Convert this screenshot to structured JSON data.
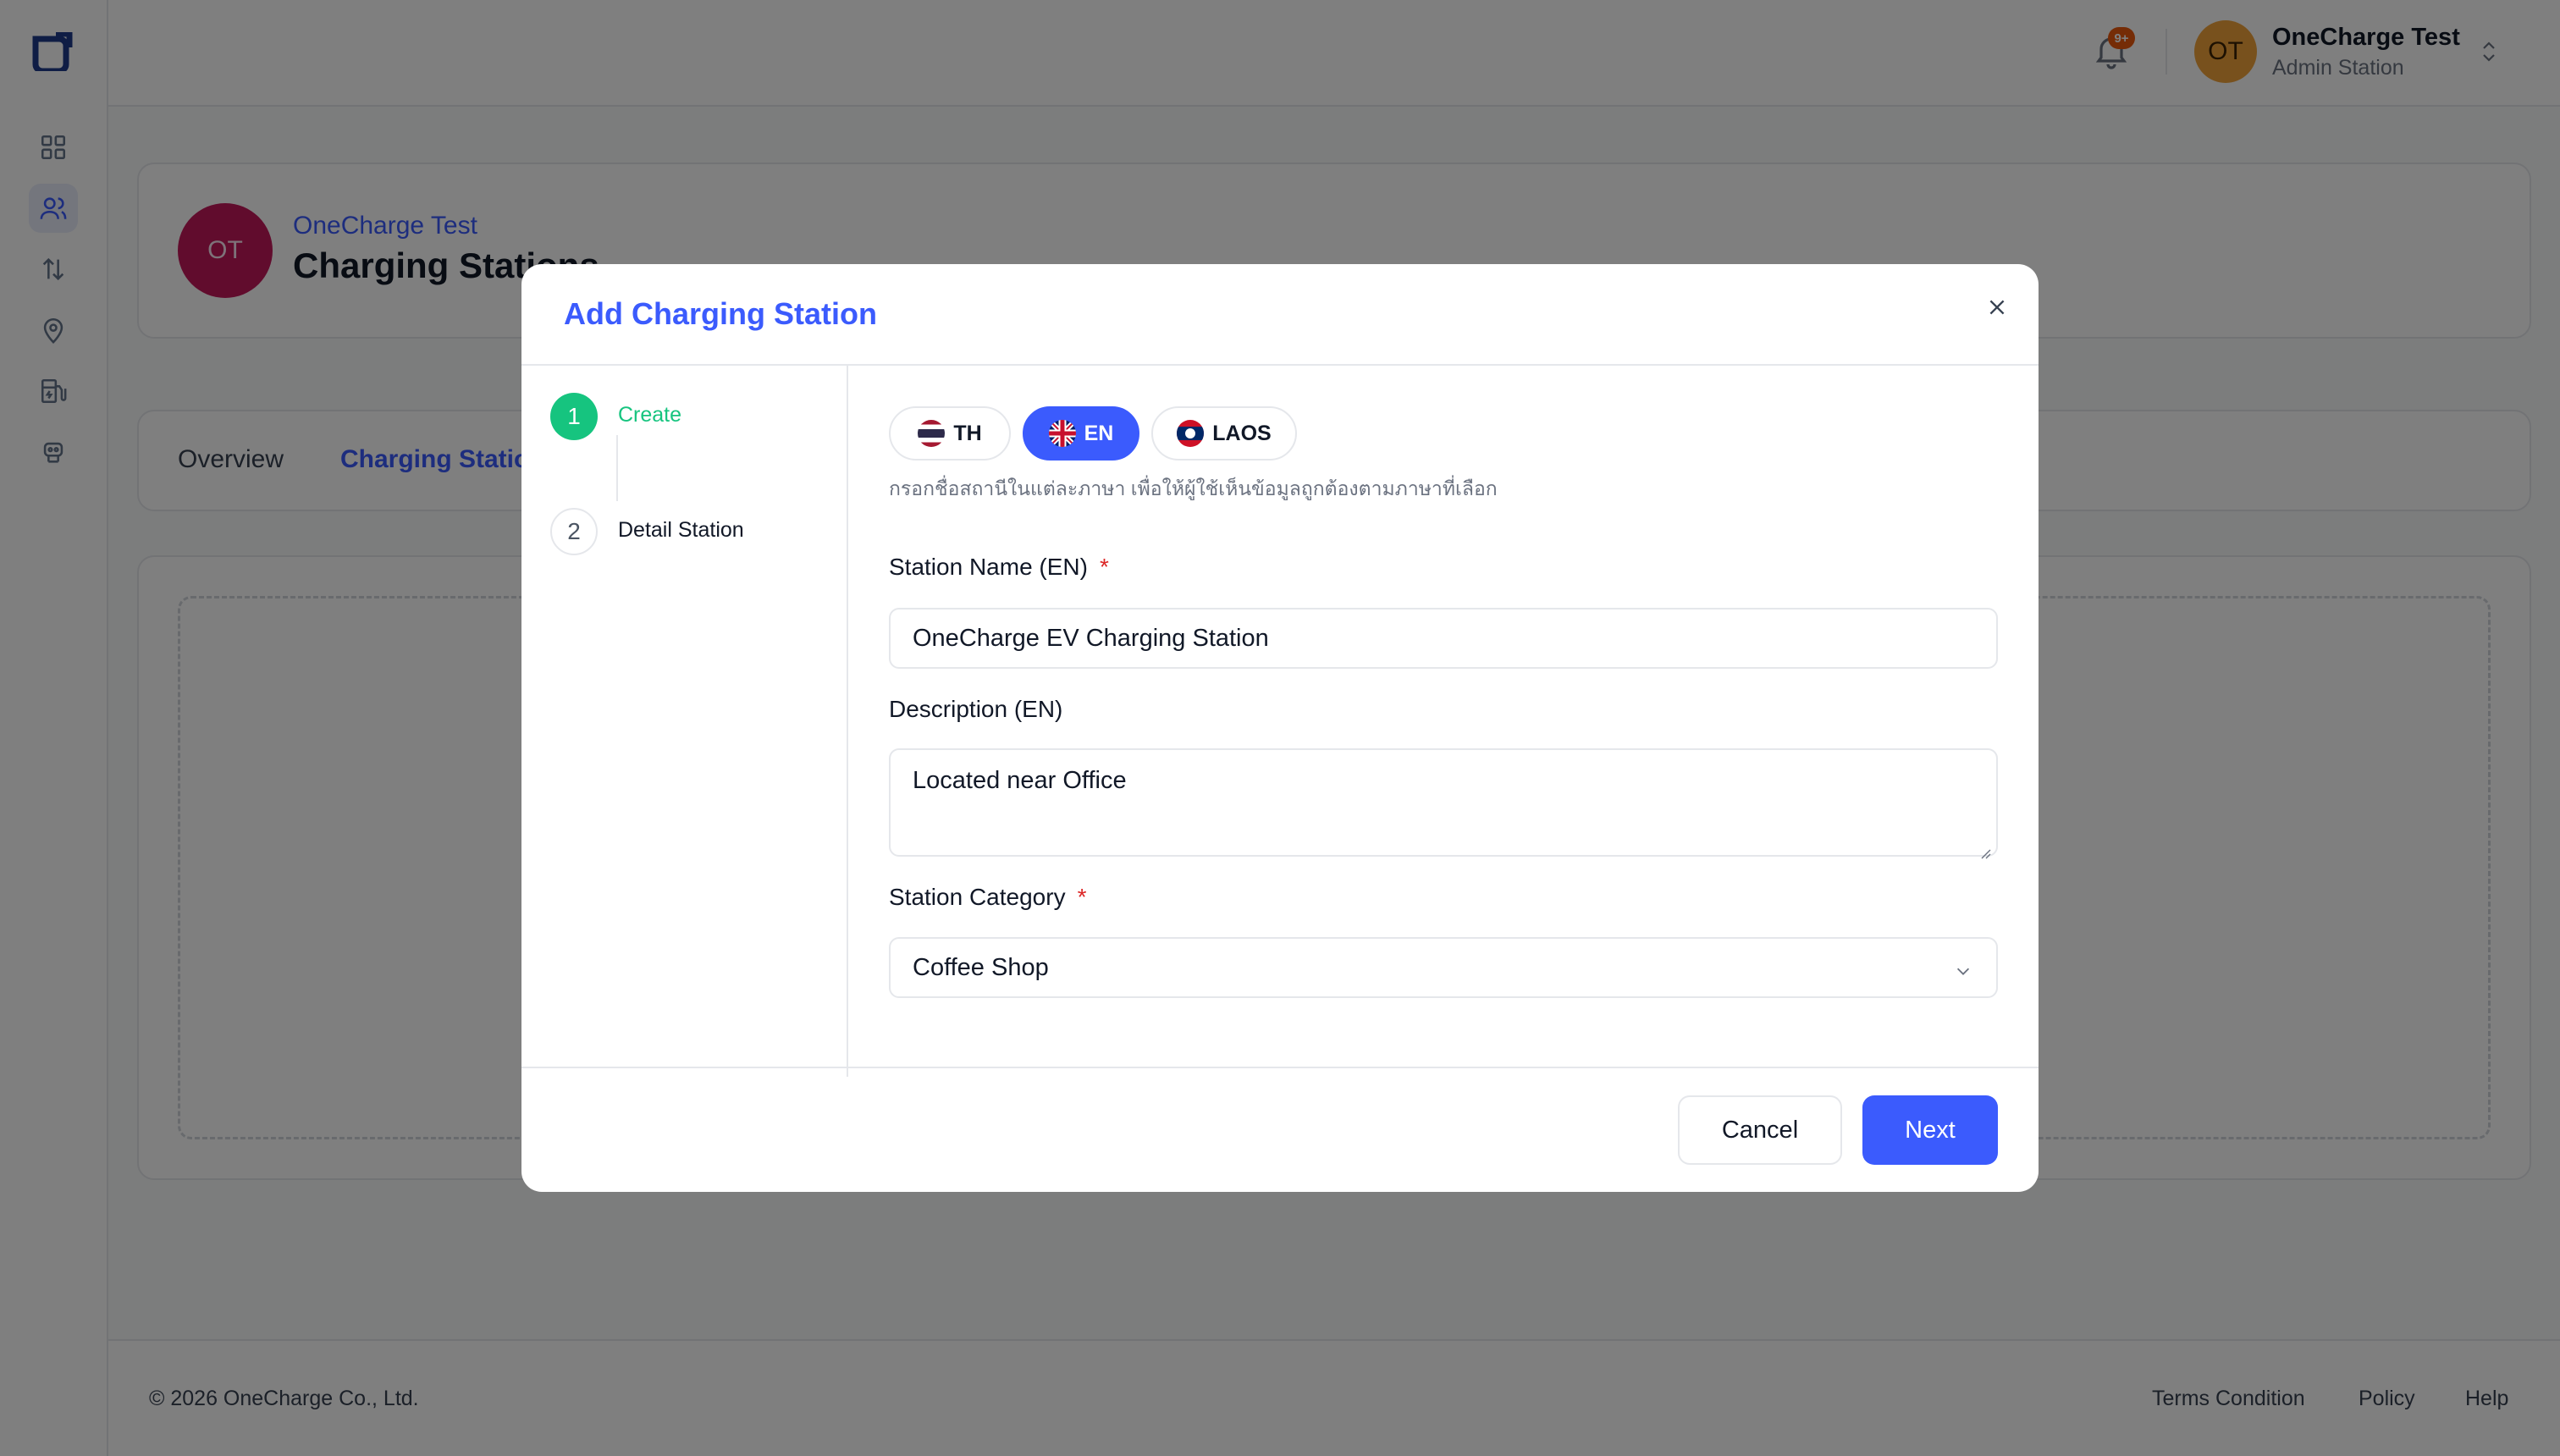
{
  "topbar": {
    "notification_badge": "9+",
    "user_initials": "OT",
    "user_name": "OneCharge Test",
    "user_role": "Admin Station"
  },
  "sidebar": {
    "items": [
      {
        "icon": "dashboard-icon"
      },
      {
        "icon": "users-icon",
        "active": true
      },
      {
        "icon": "transfer-arrows-icon"
      },
      {
        "icon": "location-pin-icon"
      },
      {
        "icon": "charger-station-icon"
      },
      {
        "icon": "robot-icon"
      }
    ]
  },
  "org": {
    "initials": "OT",
    "name": "OneCharge Test",
    "page_title": "Charging Stations"
  },
  "tabs": [
    {
      "label": "Overview"
    },
    {
      "label": "Charging Stations",
      "active": true
    }
  ],
  "modal": {
    "title": "Add Charging Station",
    "steps": [
      {
        "number": "1",
        "label": "Create",
        "status": "active"
      },
      {
        "number": "2",
        "label": "Detail Station",
        "status": "pending"
      }
    ],
    "languages": [
      {
        "code": "TH",
        "flag": "thailand-flag-icon",
        "active": false
      },
      {
        "code": "EN",
        "flag": "uk-flag-icon",
        "active": true
      },
      {
        "code": "LAOS",
        "flag": "laos-flag-icon",
        "active": false
      }
    ],
    "language_hint": "กรอกชื่อสถานีในแต่ละภาษา เพื่อให้ผู้ใช้เห็นข้อมูลถูกต้องตามภาษาที่เลือก",
    "fields": {
      "station_name": {
        "label": "Station Name (EN)",
        "required_mark": "*",
        "value": "OneCharge EV Charging Station"
      },
      "description": {
        "label": "Description (EN)",
        "value": "Located near Office"
      },
      "category": {
        "label": "Station Category",
        "required_mark": "*",
        "value": "Coffee Shop"
      }
    },
    "buttons": {
      "cancel": "Cancel",
      "next": "Next"
    }
  },
  "footer": {
    "copyright": "© 2026 OneCharge Co., Ltd.",
    "links": [
      "Terms Condition",
      "Policy",
      "Help"
    ]
  },
  "colors": {
    "accent": "#3b5bfd",
    "success": "#16c47f",
    "required": "#dc2626",
    "badge": "#ea580c"
  }
}
